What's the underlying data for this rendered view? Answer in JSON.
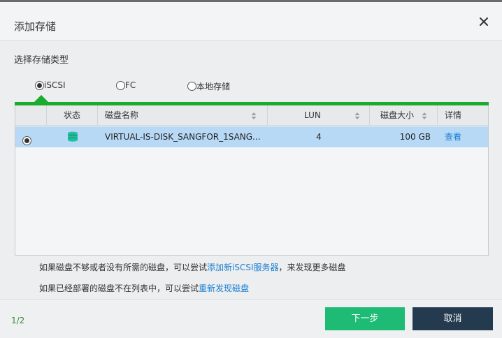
{
  "dialog": {
    "title": "添加存储",
    "section_label": "选择存储类型"
  },
  "storage_types": [
    {
      "label": "iSCSI",
      "selected": true
    },
    {
      "label": "FC",
      "selected": false
    },
    {
      "label": "本地存储",
      "selected": false
    }
  ],
  "table": {
    "columns": [
      "状态",
      "磁盘名称",
      "LUN",
      "磁盘大小",
      "详情"
    ],
    "rows": [
      {
        "selected": true,
        "status_icon": "disk-stack-icon",
        "disk_name": "VIRTUAL-IS-DISK_SANGFOR_1SANG...",
        "lun": "4",
        "size": "100 GB",
        "detail_link": "查看"
      }
    ]
  },
  "hints": {
    "line1_prefix": "如果磁盘不够或者没有所需的磁盘，可以尝试",
    "line1_link": "添加新iSCSI服务器",
    "line1_suffix": "，来发现更多磁盘",
    "line2_prefix": "如果已经部署的磁盘不在列表中，可以尝试",
    "line2_link": "重新发现磁盘"
  },
  "footer": {
    "page_indicator": "1/2",
    "next_label": "下一步",
    "cancel_label": "取消"
  },
  "colors": {
    "accent_green": "#1aad2d",
    "next_button": "#1dbb73",
    "cancel_button": "#243a4f",
    "selected_row": "#b8d9f6",
    "link": "#1a7fd4",
    "status_icon": "#1fbf9f"
  }
}
